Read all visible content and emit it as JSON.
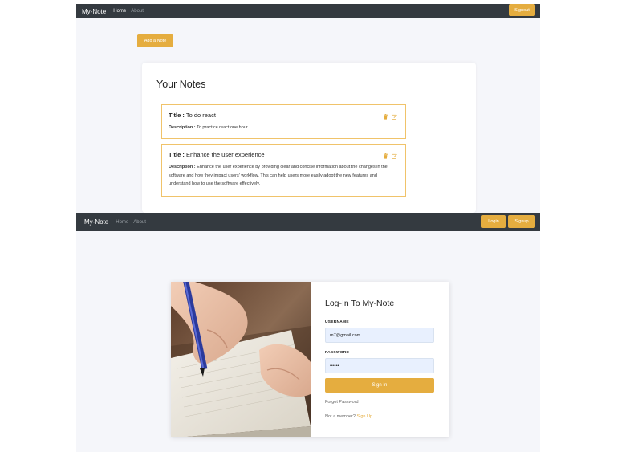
{
  "colors": {
    "accent": "#e5ad3f",
    "navbar": "#343a40",
    "page_bg": "#f5f6fa",
    "note_border": "#f0c36a"
  },
  "notes_screen": {
    "navbar": {
      "brand": "My-Note",
      "links": [
        "Home",
        "About"
      ],
      "signout_label": "Signout"
    },
    "add_note_label": "Add a Note",
    "heading": "Your Notes",
    "title_prefix": "Title :",
    "desc_prefix": "Description :",
    "notes": [
      {
        "title": "To do react",
        "description": "To practice react one hour."
      },
      {
        "title": "Enhance the user experience",
        "description": "Enhance the user experience by providing clear and concise information about the changes in the software and how they impact users' workflow. This can help users more easily adopt the new features and understand how to use the software effectively."
      }
    ],
    "icons": [
      "trash-icon",
      "edit-icon"
    ]
  },
  "login_screen": {
    "navbar": {
      "brand": "My-Note",
      "links": [
        "Home",
        "About"
      ],
      "login_label": "Login",
      "signup_label": "Signup"
    },
    "title": "Log-In To My-Note",
    "username_label": "USERNAME",
    "username_value": "m7@gmail.com",
    "password_label": "PASSWORD",
    "password_value": "••••••",
    "signin_label": "Sign In",
    "forgot_label": "Forgot Password",
    "member_text": "Not a member?",
    "signup_link": "Sign Up"
  }
}
